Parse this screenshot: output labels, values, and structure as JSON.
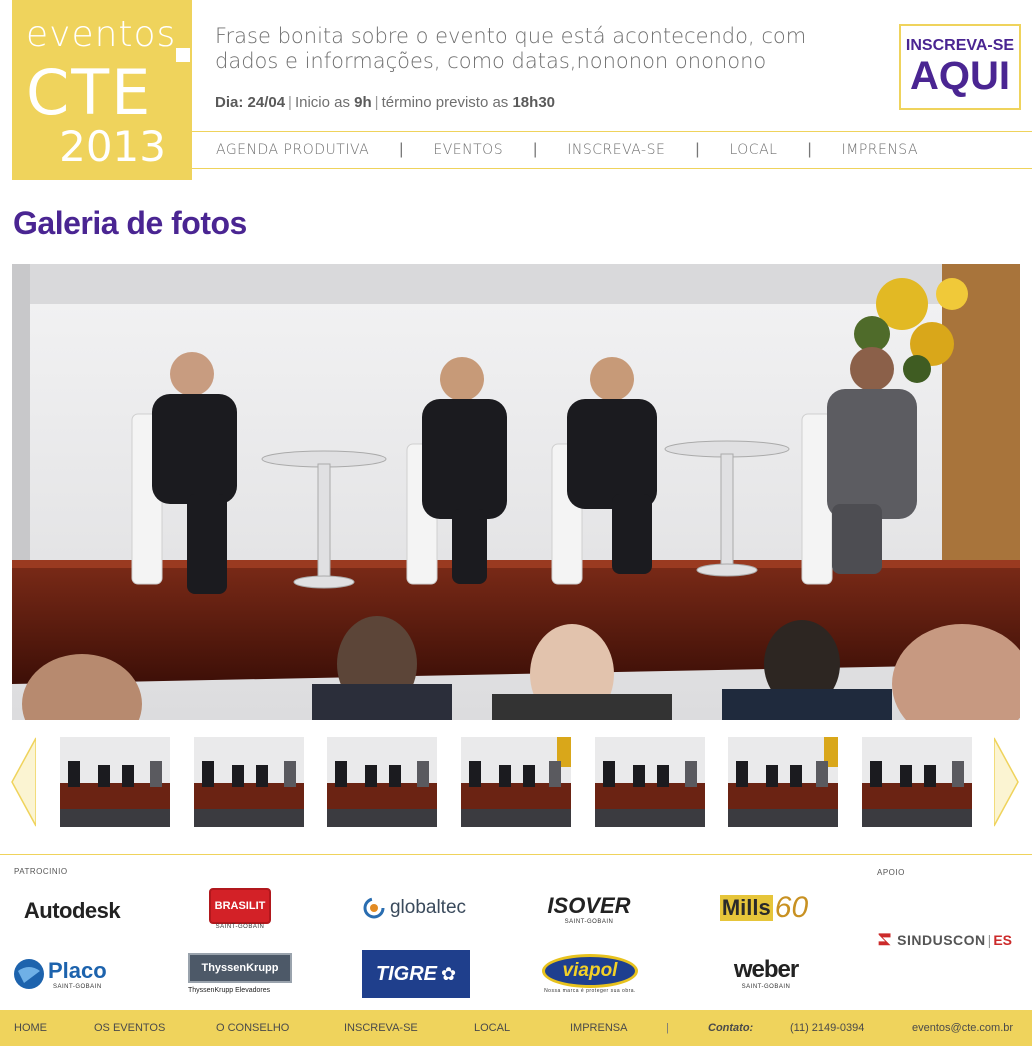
{
  "logo": {
    "line1": "eventos",
    "line2": "CTE",
    "line3": "2013"
  },
  "header": {
    "tagline": "Frase bonita sobre o evento que está acontecendo, com dados e informações, como datas,nononon ononono",
    "date_label": "Dia: 24/04",
    "start_text": "Inicio as",
    "start_time": "9h",
    "end_text": "término previsto as",
    "end_time": "18h30"
  },
  "cta": {
    "line1": "INSCREVA-SE",
    "line2": "AQUI"
  },
  "nav": [
    "AGENDA PRODUTIVA",
    "EVENTOS",
    "INSCREVA-SE",
    "LOCAL",
    "IMPRENSA"
  ],
  "page_title": "Galeria de fotos",
  "sections": {
    "sponsors_label": "PATROCINIO",
    "support_label": "APOIO"
  },
  "sponsors": {
    "autodesk": "Autodesk",
    "brasilit": "BRASILIT",
    "brasilit_sub": "SAINT-GOBAIN",
    "globaltec": "globaltec",
    "isover": "ISOVER",
    "isover_sub": "SAINT-GOBAIN",
    "mills": "Mills",
    "mills_years": "60",
    "placo": "Placo",
    "placo_sub": "SAINT-GOBAIN",
    "thyssen": "ThyssenKrupp",
    "thyssen_sub": "ThyssenKrupp Elevadores",
    "tigre": "TIGRE",
    "viapol": "viapol",
    "viapol_sub": "Nossa marca é proteger sua obra.",
    "weber": "weber",
    "weber_sub": "SAINT-GOBAIN"
  },
  "support": {
    "sinduscon": "SINDUSCON",
    "sinduscon_es": "ES"
  },
  "footer": {
    "links": [
      "HOME",
      "OS EVENTOS",
      "O CONSELHO",
      "INSCREVA-SE",
      "LOCAL",
      "IMPRENSA"
    ],
    "contact_label": "Contato:",
    "phone": "(11) 2149-0394",
    "email": "eventos@cte.com.br"
  },
  "colors": {
    "brand_yellow": "#efd35c",
    "brand_purple": "#4a2592"
  }
}
